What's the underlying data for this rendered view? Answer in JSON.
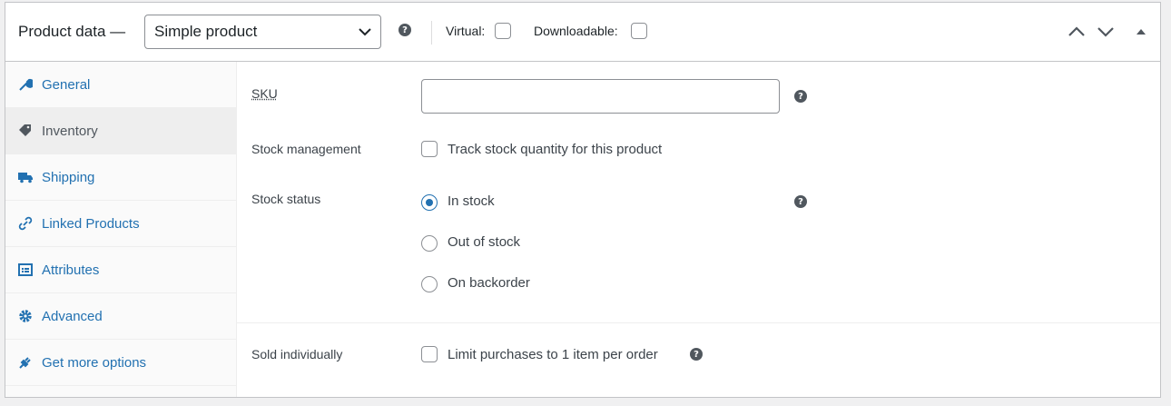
{
  "header": {
    "title": "Product data —",
    "product_type": {
      "selected": "Simple product",
      "chevron_icon": "chevron-down-icon"
    },
    "help_icon": "help-icon",
    "virtual_label": "Virtual:",
    "virtual_checked": false,
    "downloadable_label": "Downloadable:",
    "downloadable_checked": false,
    "controls": [
      "move-up-icon",
      "move-down-icon",
      "collapse-toggle-icon"
    ]
  },
  "tabs": [
    {
      "label": "General",
      "icon": "wrench-icon",
      "active": false
    },
    {
      "label": "Inventory",
      "icon": "tag-icon",
      "active": true
    },
    {
      "label": "Shipping",
      "icon": "truck-icon",
      "active": false
    },
    {
      "label": "Linked Products",
      "icon": "link-icon",
      "active": false
    },
    {
      "label": "Attributes",
      "icon": "list-icon",
      "active": false
    },
    {
      "label": "Advanced",
      "icon": "gear-icon",
      "active": false
    },
    {
      "label": "Get more options",
      "icon": "plugin-icon",
      "active": false
    }
  ],
  "inventory": {
    "sku": {
      "label": "SKU",
      "value": ""
    },
    "stock_management": {
      "label": "Stock management",
      "option": "Track stock quantity for this product",
      "checked": false
    },
    "stock_status": {
      "label": "Stock status",
      "options": [
        {
          "label": "In stock",
          "checked": true
        },
        {
          "label": "Out of stock",
          "checked": false
        },
        {
          "label": "On backorder",
          "checked": false
        }
      ]
    },
    "sold_individually": {
      "label": "Sold individually",
      "option": "Limit purchases to 1 item per order",
      "checked": false
    }
  },
  "colors": {
    "link": "#2271b1",
    "text": "#3c434a",
    "border": "#c3c4c7"
  }
}
